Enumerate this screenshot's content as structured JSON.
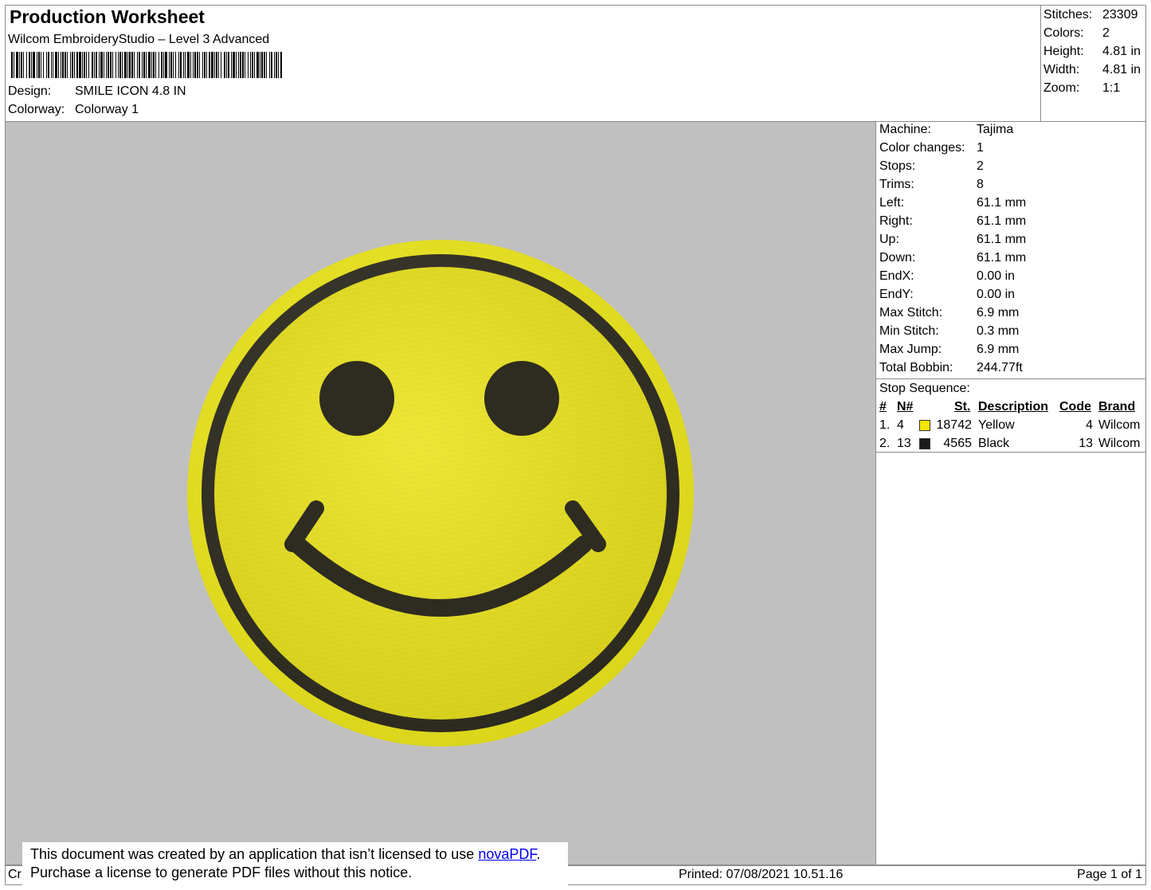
{
  "header": {
    "title": "Production Worksheet",
    "subtitle": "Wilcom EmbroideryStudio – Level 3 Advanced",
    "design_label": "Design:",
    "design_value": "SMILE ICON 4.8 IN",
    "colorway_label": "Colorway:",
    "colorway_value": "Colorway 1"
  },
  "stats": [
    {
      "label": "Stitches:",
      "value": "23309"
    },
    {
      "label": "Colors:",
      "value": "2"
    },
    {
      "label": "Height:",
      "value": "4.81 in"
    },
    {
      "label": "Width:",
      "value": "4.81 in"
    },
    {
      "label": "Zoom:",
      "value": "1:1"
    }
  ],
  "machine_info": [
    {
      "label": "Machine:",
      "value": "Tajima"
    },
    {
      "label": "Color changes:",
      "value": "1"
    },
    {
      "label": "Stops:",
      "value": "2"
    },
    {
      "label": "Trims:",
      "value": "8"
    },
    {
      "label": "Left:",
      "value": "61.1 mm"
    },
    {
      "label": "Right:",
      "value": "61.1 mm"
    },
    {
      "label": "Up:",
      "value": "61.1 mm"
    },
    {
      "label": "Down:",
      "value": "61.1 mm"
    },
    {
      "label": "EndX:",
      "value": "0.00 in"
    },
    {
      "label": "EndY:",
      "value": "0.00 in"
    },
    {
      "label": "Max Stitch:",
      "value": "6.9 mm"
    },
    {
      "label": "Min Stitch:",
      "value": "0.3 mm"
    },
    {
      "label": "Max Jump:",
      "value": "6.9 mm"
    },
    {
      "label": "Total Bobbin:",
      "value": "244.77ft"
    }
  ],
  "stop_sequence": {
    "title": "Stop Sequence:",
    "columns": [
      "#",
      "N#",
      "St.",
      "Description",
      "Code",
      "Brand"
    ],
    "rows": [
      {
        "index": "1.",
        "needle": "4",
        "color": "#f5e400",
        "stitches": "18742",
        "description": "Yellow",
        "code": "4",
        "brand": "Wilcom"
      },
      {
        "index": "2.",
        "needle": "13",
        "color": "#1a1a1a",
        "stitches": "4565",
        "description": "Black",
        "code": "13",
        "brand": "Wilcom"
      }
    ]
  },
  "design_colors": {
    "fill": "#f2ec1c",
    "outline": "#2e2c20",
    "background": "#c0c0c0"
  },
  "footer": {
    "left_text": "Cr",
    "printed": "Printed: 07/08/2021 10.51.16",
    "page": "Page 1 of 1"
  },
  "notice": {
    "line1_prefix": "This document was created by an application that isn’t licensed to use ",
    "link_text": "novaPDF",
    "line1_suffix": ".",
    "line2": "Purchase a license to generate PDF files without this notice."
  }
}
